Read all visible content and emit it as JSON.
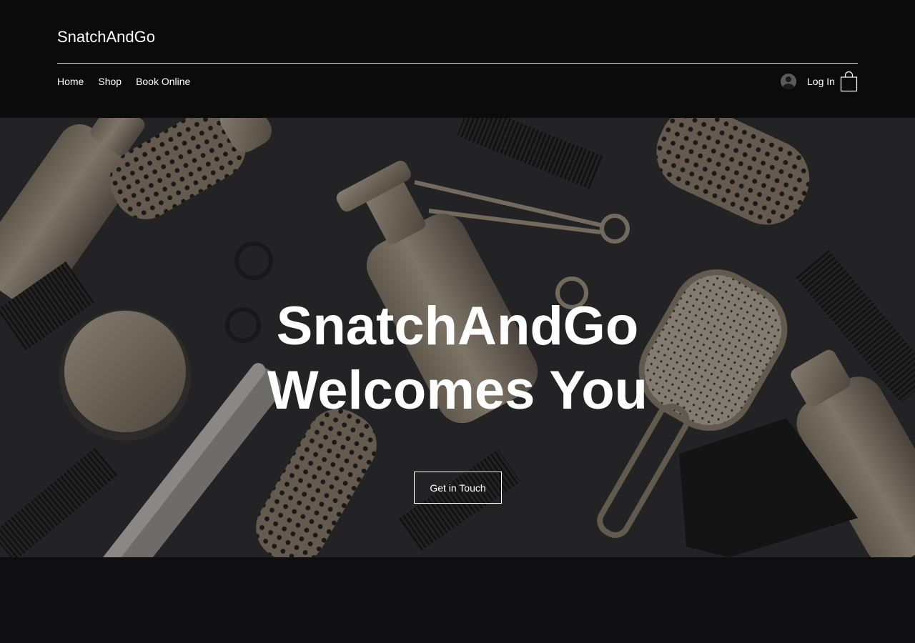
{
  "header": {
    "site_title": "SnatchAndGo",
    "nav": [
      {
        "label": "Home"
      },
      {
        "label": "Shop"
      },
      {
        "label": "Book Online"
      }
    ],
    "login_label": "Log In",
    "icons": {
      "login": "user-avatar-icon",
      "cart": "shopping-bag-icon"
    }
  },
  "hero": {
    "title_line1": "SnatchAndGo",
    "title_line2": "Welcomes You",
    "cta_label": "Get in Touch",
    "background_image": "hairdressing-tools-photo"
  },
  "colors": {
    "background": "#0d0d0e",
    "header": "#0b0b0b",
    "text": "#ffffff",
    "tool_tone": "#a39481"
  }
}
